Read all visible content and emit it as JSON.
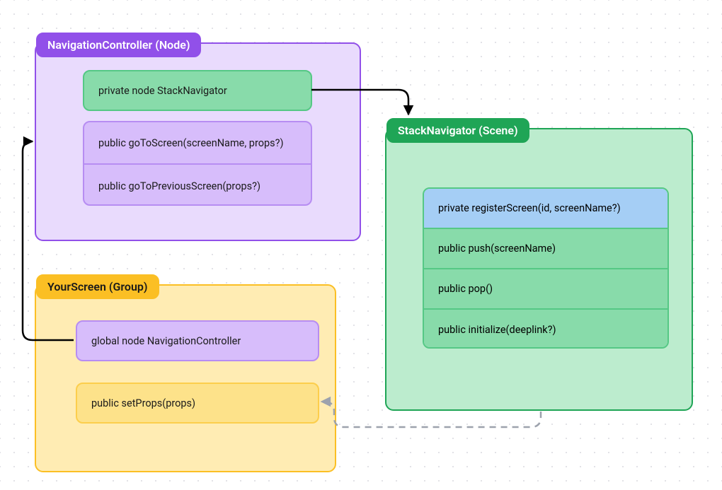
{
  "nodes": {
    "navigation": {
      "title": "NavigationController (Node)",
      "members": {
        "stackNav": "private node StackNavigator",
        "goToScreen": "public goToScreen(screenName, props?)",
        "goToPrev": "public goToPreviousScreen(props?)"
      }
    },
    "stack": {
      "title": "StackNavigator (Scene)",
      "members": {
        "register": "private registerScreen(id, screenName?)",
        "push": "public push(screenName)",
        "pop": "public pop()",
        "init": "public initialize(deeplink?)"
      }
    },
    "your": {
      "title": "YourScreen (Group)",
      "members": {
        "navCtrl": "global node NavigationController",
        "setProps": "public setProps(props)"
      }
    }
  }
}
